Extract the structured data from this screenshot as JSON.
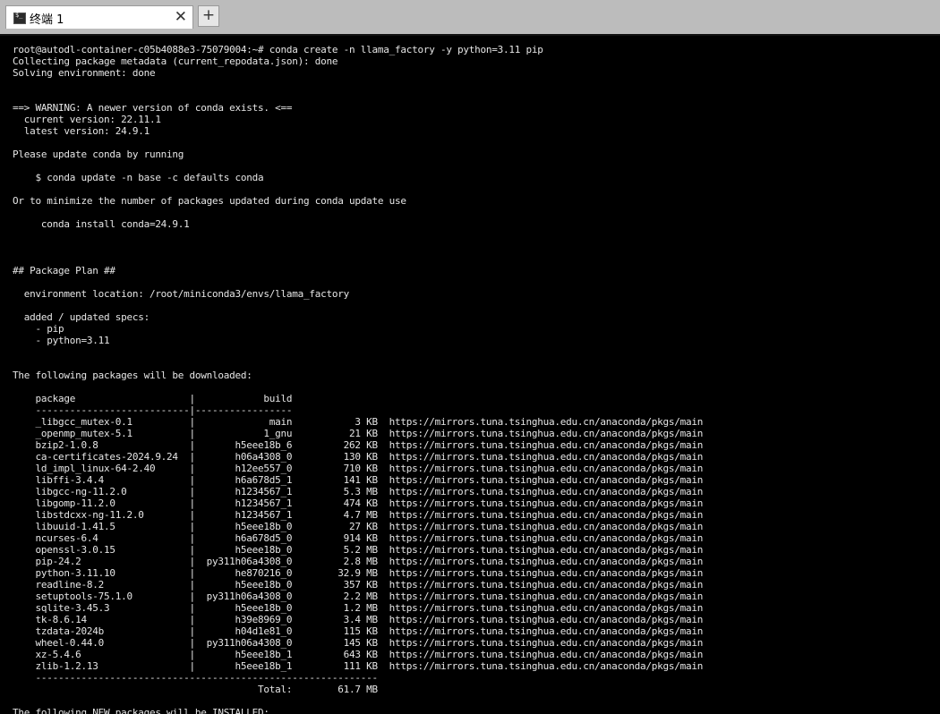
{
  "tab": {
    "title": "终端 1",
    "close_glyph": "✕",
    "new_glyph": "+",
    "icon": "terminal-icon"
  },
  "terminal": {
    "lines": [
      "root@autodl-container-c05b4088e3-75079004:~# conda create -n llama_factory -y python=3.11 pip",
      "Collecting package metadata (current_repodata.json): done",
      "Solving environment: done",
      "",
      "",
      "==> WARNING: A newer version of conda exists. <==",
      "  current version: 22.11.1",
      "  latest version: 24.9.1",
      "",
      "Please update conda by running",
      "",
      "    $ conda update -n base -c defaults conda",
      "",
      "Or to minimize the number of packages updated during conda update use",
      "",
      "     conda install conda=24.9.1",
      "",
      "",
      "",
      "## Package Plan ##",
      "",
      "  environment location: /root/miniconda3/envs/llama_factory",
      "",
      "  added / updated specs:",
      "    - pip",
      "    - python=3.11",
      "",
      "",
      "The following packages will be downloaded:",
      "",
      "    package                    |            build",
      "    ---------------------------|-----------------",
      "    _libgcc_mutex-0.1          |             main           3 KB  https://mirrors.tuna.tsinghua.edu.cn/anaconda/pkgs/main",
      "    _openmp_mutex-5.1          |            1_gnu          21 KB  https://mirrors.tuna.tsinghua.edu.cn/anaconda/pkgs/main",
      "    bzip2-1.0.8                |       h5eee18b_6         262 KB  https://mirrors.tuna.tsinghua.edu.cn/anaconda/pkgs/main",
      "    ca-certificates-2024.9.24  |       h06a4308_0         130 KB  https://mirrors.tuna.tsinghua.edu.cn/anaconda/pkgs/main",
      "    ld_impl_linux-64-2.40      |       h12ee557_0         710 KB  https://mirrors.tuna.tsinghua.edu.cn/anaconda/pkgs/main",
      "    libffi-3.4.4               |       h6a678d5_1         141 KB  https://mirrors.tuna.tsinghua.edu.cn/anaconda/pkgs/main",
      "    libgcc-ng-11.2.0           |       h1234567_1         5.3 MB  https://mirrors.tuna.tsinghua.edu.cn/anaconda/pkgs/main",
      "    libgomp-11.2.0             |       h1234567_1         474 KB  https://mirrors.tuna.tsinghua.edu.cn/anaconda/pkgs/main",
      "    libstdcxx-ng-11.2.0        |       h1234567_1         4.7 MB  https://mirrors.tuna.tsinghua.edu.cn/anaconda/pkgs/main",
      "    libuuid-1.41.5             |       h5eee18b_0          27 KB  https://mirrors.tuna.tsinghua.edu.cn/anaconda/pkgs/main",
      "    ncurses-6.4                |       h6a678d5_0         914 KB  https://mirrors.tuna.tsinghua.edu.cn/anaconda/pkgs/main",
      "    openssl-3.0.15             |       h5eee18b_0         5.2 MB  https://mirrors.tuna.tsinghua.edu.cn/anaconda/pkgs/main",
      "    pip-24.2                   |  py311h06a4308_0         2.8 MB  https://mirrors.tuna.tsinghua.edu.cn/anaconda/pkgs/main",
      "    python-3.11.10             |       he870216_0        32.9 MB  https://mirrors.tuna.tsinghua.edu.cn/anaconda/pkgs/main",
      "    readline-8.2               |       h5eee18b_0         357 KB  https://mirrors.tuna.tsinghua.edu.cn/anaconda/pkgs/main",
      "    setuptools-75.1.0          |  py311h06a4308_0         2.2 MB  https://mirrors.tuna.tsinghua.edu.cn/anaconda/pkgs/main",
      "    sqlite-3.45.3              |       h5eee18b_0         1.2 MB  https://mirrors.tuna.tsinghua.edu.cn/anaconda/pkgs/main",
      "    tk-8.6.14                  |       h39e8969_0         3.4 MB  https://mirrors.tuna.tsinghua.edu.cn/anaconda/pkgs/main",
      "    tzdata-2024b               |       h04d1e81_0         115 KB  https://mirrors.tuna.tsinghua.edu.cn/anaconda/pkgs/main",
      "    wheel-0.44.0               |  py311h06a4308_0         145 KB  https://mirrors.tuna.tsinghua.edu.cn/anaconda/pkgs/main",
      "    xz-5.4.6                   |       h5eee18b_1         643 KB  https://mirrors.tuna.tsinghua.edu.cn/anaconda/pkgs/main",
      "    zlib-1.2.13                |       h5eee18b_1         111 KB  https://mirrors.tuna.tsinghua.edu.cn/anaconda/pkgs/main",
      "    ------------------------------------------------------------",
      "                                           Total:        61.7 MB",
      "",
      "The following NEW packages will be INSTALLED:"
    ]
  }
}
